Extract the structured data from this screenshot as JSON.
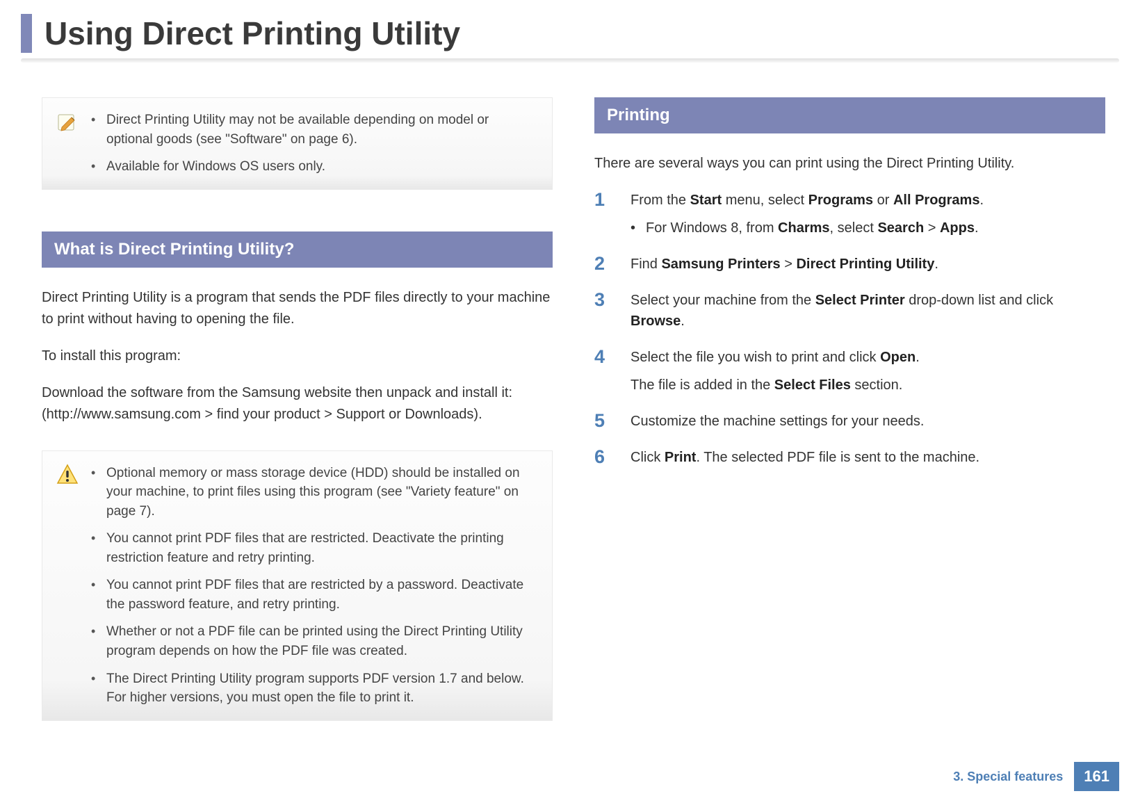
{
  "page_title": "Using Direct Printing Utility",
  "note_box": {
    "items": [
      " Direct Printing Utility may not be available depending on model or optional goods (see \"Software\" on page 6).",
      "Available for Windows OS users only."
    ]
  },
  "left": {
    "heading": "What is Direct Printing Utility?",
    "para1": "Direct Printing Utility is a program that sends the PDF files directly to your machine to print without having to opening the file.",
    "para2": "To install this program:",
    "para3": "Download the software from the Samsung website then unpack and install it: (http://www.samsung.com > find your product > Support or Downloads).",
    "warn_items": [
      "Optional memory or mass storage device (HDD) should be installed on your machine, to print files using this program (see \"Variety feature\" on page 7).",
      "You cannot print PDF files that are restricted. Deactivate the printing restriction feature and retry printing.",
      "You cannot print PDF files that are restricted by a password. Deactivate the password feature, and retry printing.",
      "Whether or not a PDF file can be printed using the Direct Printing Utility program depends on how the PDF file was created.",
      "The Direct Printing Utility program supports PDF version 1.7 and below. For higher versions, you must open the file to print it."
    ]
  },
  "right": {
    "heading": "Printing",
    "intro": "There are several ways you can print using the Direct Printing Utility.",
    "steps": {
      "s1_num": "1",
      "s1_main_pre": "From the ",
      "s1_b1": "Start",
      "s1_mid1": " menu, select ",
      "s1_b2": "Programs",
      "s1_mid2": " or ",
      "s1_b3": "All Programs",
      "s1_end": ".",
      "s1_sub_pre": "For Windows 8, from ",
      "s1_sub_b1": "Charms",
      "s1_sub_mid": ", select ",
      "s1_sub_b2": "Search",
      "s1_sub_gt": " > ",
      "s1_sub_b3": "Apps",
      "s1_sub_end": ".",
      "s2_num": "2",
      "s2_pre": "Find ",
      "s2_b1": "Samsung Printers",
      "s2_gt": " > ",
      "s2_b2": "Direct Printing Utility",
      "s2_end": ".",
      "s3_num": "3",
      "s3_pre": "Select your machine from the ",
      "s3_b1": "Select Printer",
      "s3_mid": " drop-down list and click ",
      "s3_b2": "Browse",
      "s3_end": ".",
      "s4_num": "4",
      "s4_line1_pre": "Select the file you wish to print and click ",
      "s4_line1_b": "Open",
      "s4_line1_end": ".",
      "s4_line2_pre": "The file is added in the ",
      "s4_line2_b": "Select Files",
      "s4_line2_end": " section.",
      "s5_num": "5",
      "s5_text": "Customize the machine settings for your needs.",
      "s6_num": "6",
      "s6_pre": "Click ",
      "s6_b": "Print",
      "s6_end": ". The selected PDF file is sent to the machine."
    }
  },
  "footer": {
    "chapter": "3.  Special features",
    "page": "161"
  }
}
